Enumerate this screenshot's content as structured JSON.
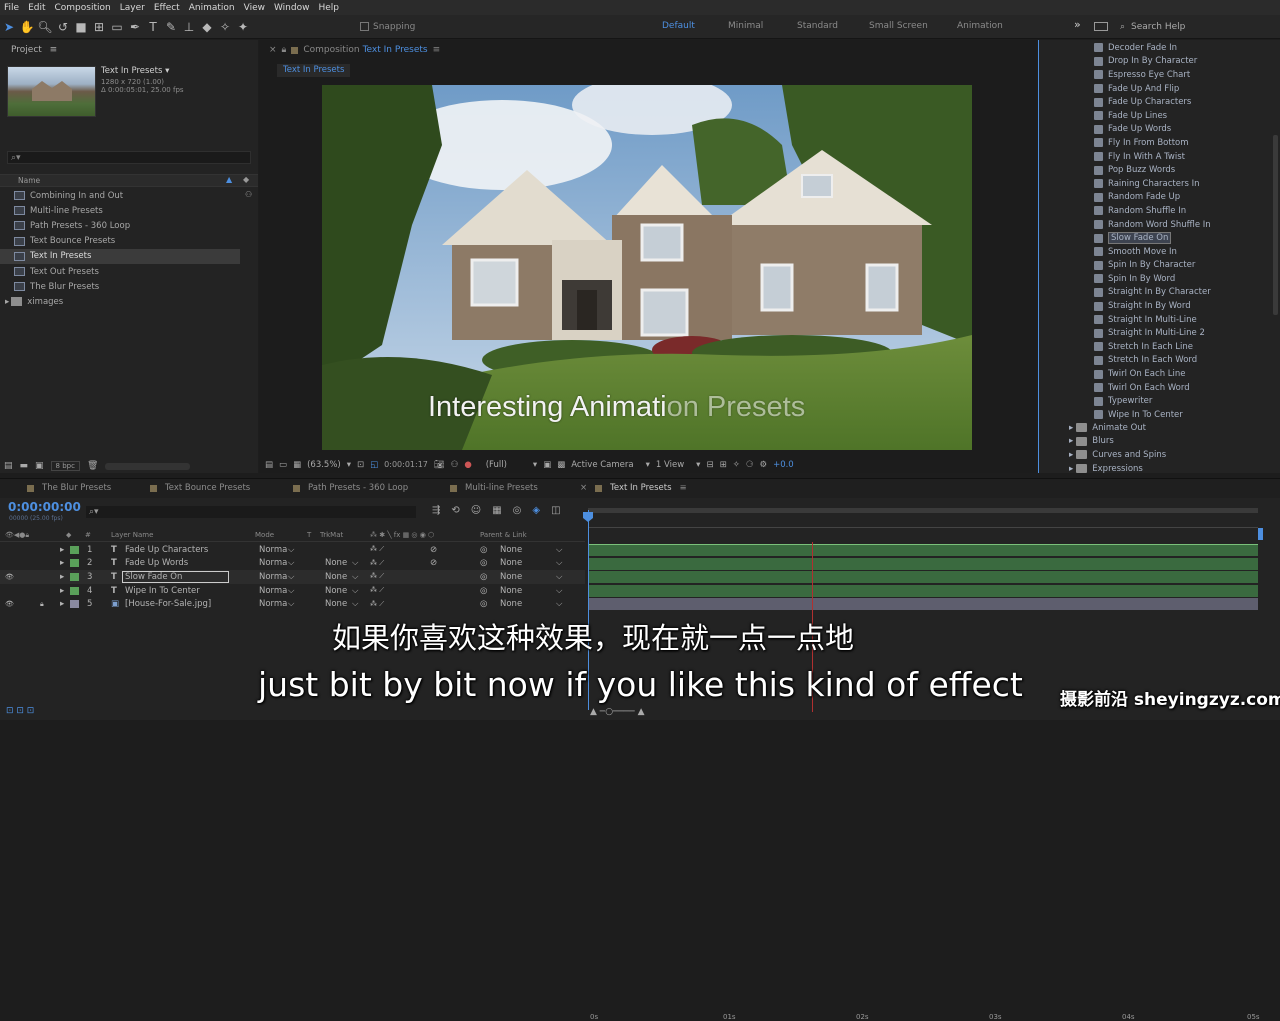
{
  "menu": [
    "File",
    "Edit",
    "Composition",
    "Layer",
    "Effect",
    "Animation",
    "View",
    "Window",
    "Help"
  ],
  "toolbar": {
    "snapping": "Snapping",
    "workspaces": [
      "Default",
      "Minimal",
      "Standard",
      "Small Screen",
      "Animation"
    ],
    "search_help": "Search Help",
    "overflow": "»"
  },
  "project": {
    "title": "Project",
    "comp_name": "Text In Presets",
    "comp_size": "1280 x 720 (1.00)",
    "comp_duration": "Δ 0:00:05:01, 25.00 fps",
    "search_placeholder": "",
    "col_name": "Name",
    "items": [
      {
        "label": "Combining In and Out",
        "selected": false
      },
      {
        "label": "Multi-line Presets",
        "selected": false
      },
      {
        "label": "Path Presets - 360 Loop",
        "selected": false
      },
      {
        "label": "Text Bounce Presets",
        "selected": false
      },
      {
        "label": "Text In Presets",
        "selected": true
      },
      {
        "label": "Text Out Presets",
        "selected": false
      },
      {
        "label": "The Blur Presets",
        "selected": false
      },
      {
        "label": "ximages",
        "selected": false
      }
    ],
    "bpc": "8 bpc"
  },
  "viewer": {
    "tab_title": "Composition",
    "tab_comp": "Text In Presets",
    "sub_tab": "Text In Presets",
    "overlay_text_a": "Interesting Animati",
    "overlay_text_b": "on Presets",
    "zoom": "(63.5%)",
    "timecode": "0:00:01:17",
    "resolution": "(Full)",
    "camera": "Active Camera",
    "views": "1 View",
    "exposure": "+0.0"
  },
  "effects": {
    "items": [
      "Decoder Fade In",
      "Drop In By Character",
      "Espresso Eye Chart",
      "Fade Up And Flip",
      "Fade Up Characters",
      "Fade Up Lines",
      "Fade Up Words",
      "Fly In From Bottom",
      "Fly In With A Twist",
      "Pop Buzz Words",
      "Raining Characters In",
      "Random Fade Up",
      "Random Shuffle In",
      "Random Word Shuffle In",
      "Slow Fade On",
      "Smooth Move In",
      "Spin In By Character",
      "Spin In By Word",
      "Straight In By Character",
      "Straight In By Word",
      "Straight In Multi-Line",
      "Straight In Multi-Line 2",
      "Stretch In Each Line",
      "Stretch In Each Word",
      "Twirl On Each Line",
      "Twirl On Each Word",
      "Typewriter",
      "Wipe In To Center"
    ],
    "selected": "Slow Fade On",
    "folders": [
      "Animate Out",
      "Blurs",
      "Curves and Spins",
      "Expressions"
    ]
  },
  "timeline": {
    "tabs": [
      "The Blur Presets",
      "Text Bounce Presets",
      "Path Presets - 360 Loop",
      "Multi-line Presets",
      "Text In Presets"
    ],
    "timecode": "0:00:00:00",
    "timecode_sub": "00000 (25.00 fps)",
    "columns": {
      "num": "#",
      "layer_name": "Layer Name",
      "mode": "Mode",
      "t": "T",
      "trkmat": "TrkMat",
      "parent": "Parent & Link"
    },
    "layers": [
      {
        "num": "1",
        "type": "T",
        "name": "Fade Up Characters",
        "mode": "Norma",
        "trkmat": "",
        "parent": "None",
        "color": "#5aa05a"
      },
      {
        "num": "2",
        "type": "T",
        "name": "Fade Up Words",
        "mode": "Norma",
        "trkmat": "None",
        "parent": "None",
        "color": "#5aa05a"
      },
      {
        "num": "3",
        "type": "T",
        "name": "Slow Fade On",
        "mode": "Norma",
        "trkmat": "None",
        "parent": "None",
        "color": "#5aa05a"
      },
      {
        "num": "4",
        "type": "T",
        "name": "Wipe In To Center",
        "mode": "Norma",
        "trkmat": "None",
        "parent": "None",
        "color": "#5aa05a"
      },
      {
        "num": "5",
        "type": "img",
        "name": "[House-For-Sale.jpg]",
        "mode": "Norma",
        "trkmat": "None",
        "parent": "None",
        "color": "#8a8aa0"
      }
    ],
    "ruler": [
      "0s",
      "01s",
      "02s",
      "03s",
      "04s",
      "05s"
    ]
  },
  "subtitles": {
    "chinese": "如果你喜欢这种效果，现在就一点一点地",
    "english": "just bit by bit now if you like this kind of effect"
  },
  "watermark": "摄影前沿 sheyingzyz.com"
}
